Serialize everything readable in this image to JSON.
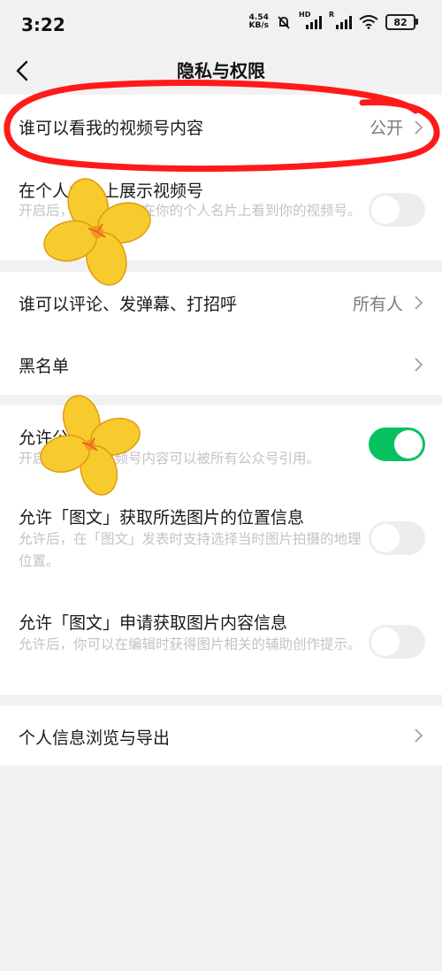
{
  "status": {
    "time": "3:22",
    "net_speed_value": "4.54",
    "net_speed_unit": "KB/s",
    "sim1_tag": "HD",
    "sim2_tag": "R",
    "battery": "82",
    "icons": [
      "mute-bell-icon",
      "signal-icon",
      "wifi-icon",
      "battery-icon"
    ]
  },
  "nav": {
    "title": "隐私与权限"
  },
  "sections": {
    "video": {
      "who_can_see": {
        "title": "谁可以看我的视频号内容",
        "value": "公开"
      },
      "show_on_card": {
        "title": "在个人名片上展示视频号",
        "subtitle": "开启后，其他人可以在你的个人名片上看到你的视频号。",
        "enabled": false
      }
    },
    "interaction": {
      "comment": {
        "title": "谁可以评论、发弹幕、打招呼",
        "value": "所有人"
      },
      "blacklist": {
        "title": "黑名单"
      }
    },
    "permissions": {
      "allow_quote": {
        "title": "允许公众号引用",
        "subtitle": "开启后，你的视频号内容可以被所有公众号引用。",
        "enabled": true
      },
      "allow_location": {
        "title": "允许「图文」获取所选图片的位置信息",
        "subtitle": "允许后，在「图文」发表时支持选择当时图片拍摄的地理位置。",
        "enabled": false
      },
      "allow_content": {
        "title": "允许「图文」申请获取图片内容信息",
        "subtitle": "允许后，你可以在编辑时获得图片相关的辅助创作提示。",
        "enabled": false
      }
    },
    "export": {
      "title": "个人信息浏览与导出"
    }
  },
  "colors": {
    "accent_green": "#07c160",
    "annotation_red": "#ff1a1a",
    "sticker_yellow": "#f7cb2e"
  }
}
